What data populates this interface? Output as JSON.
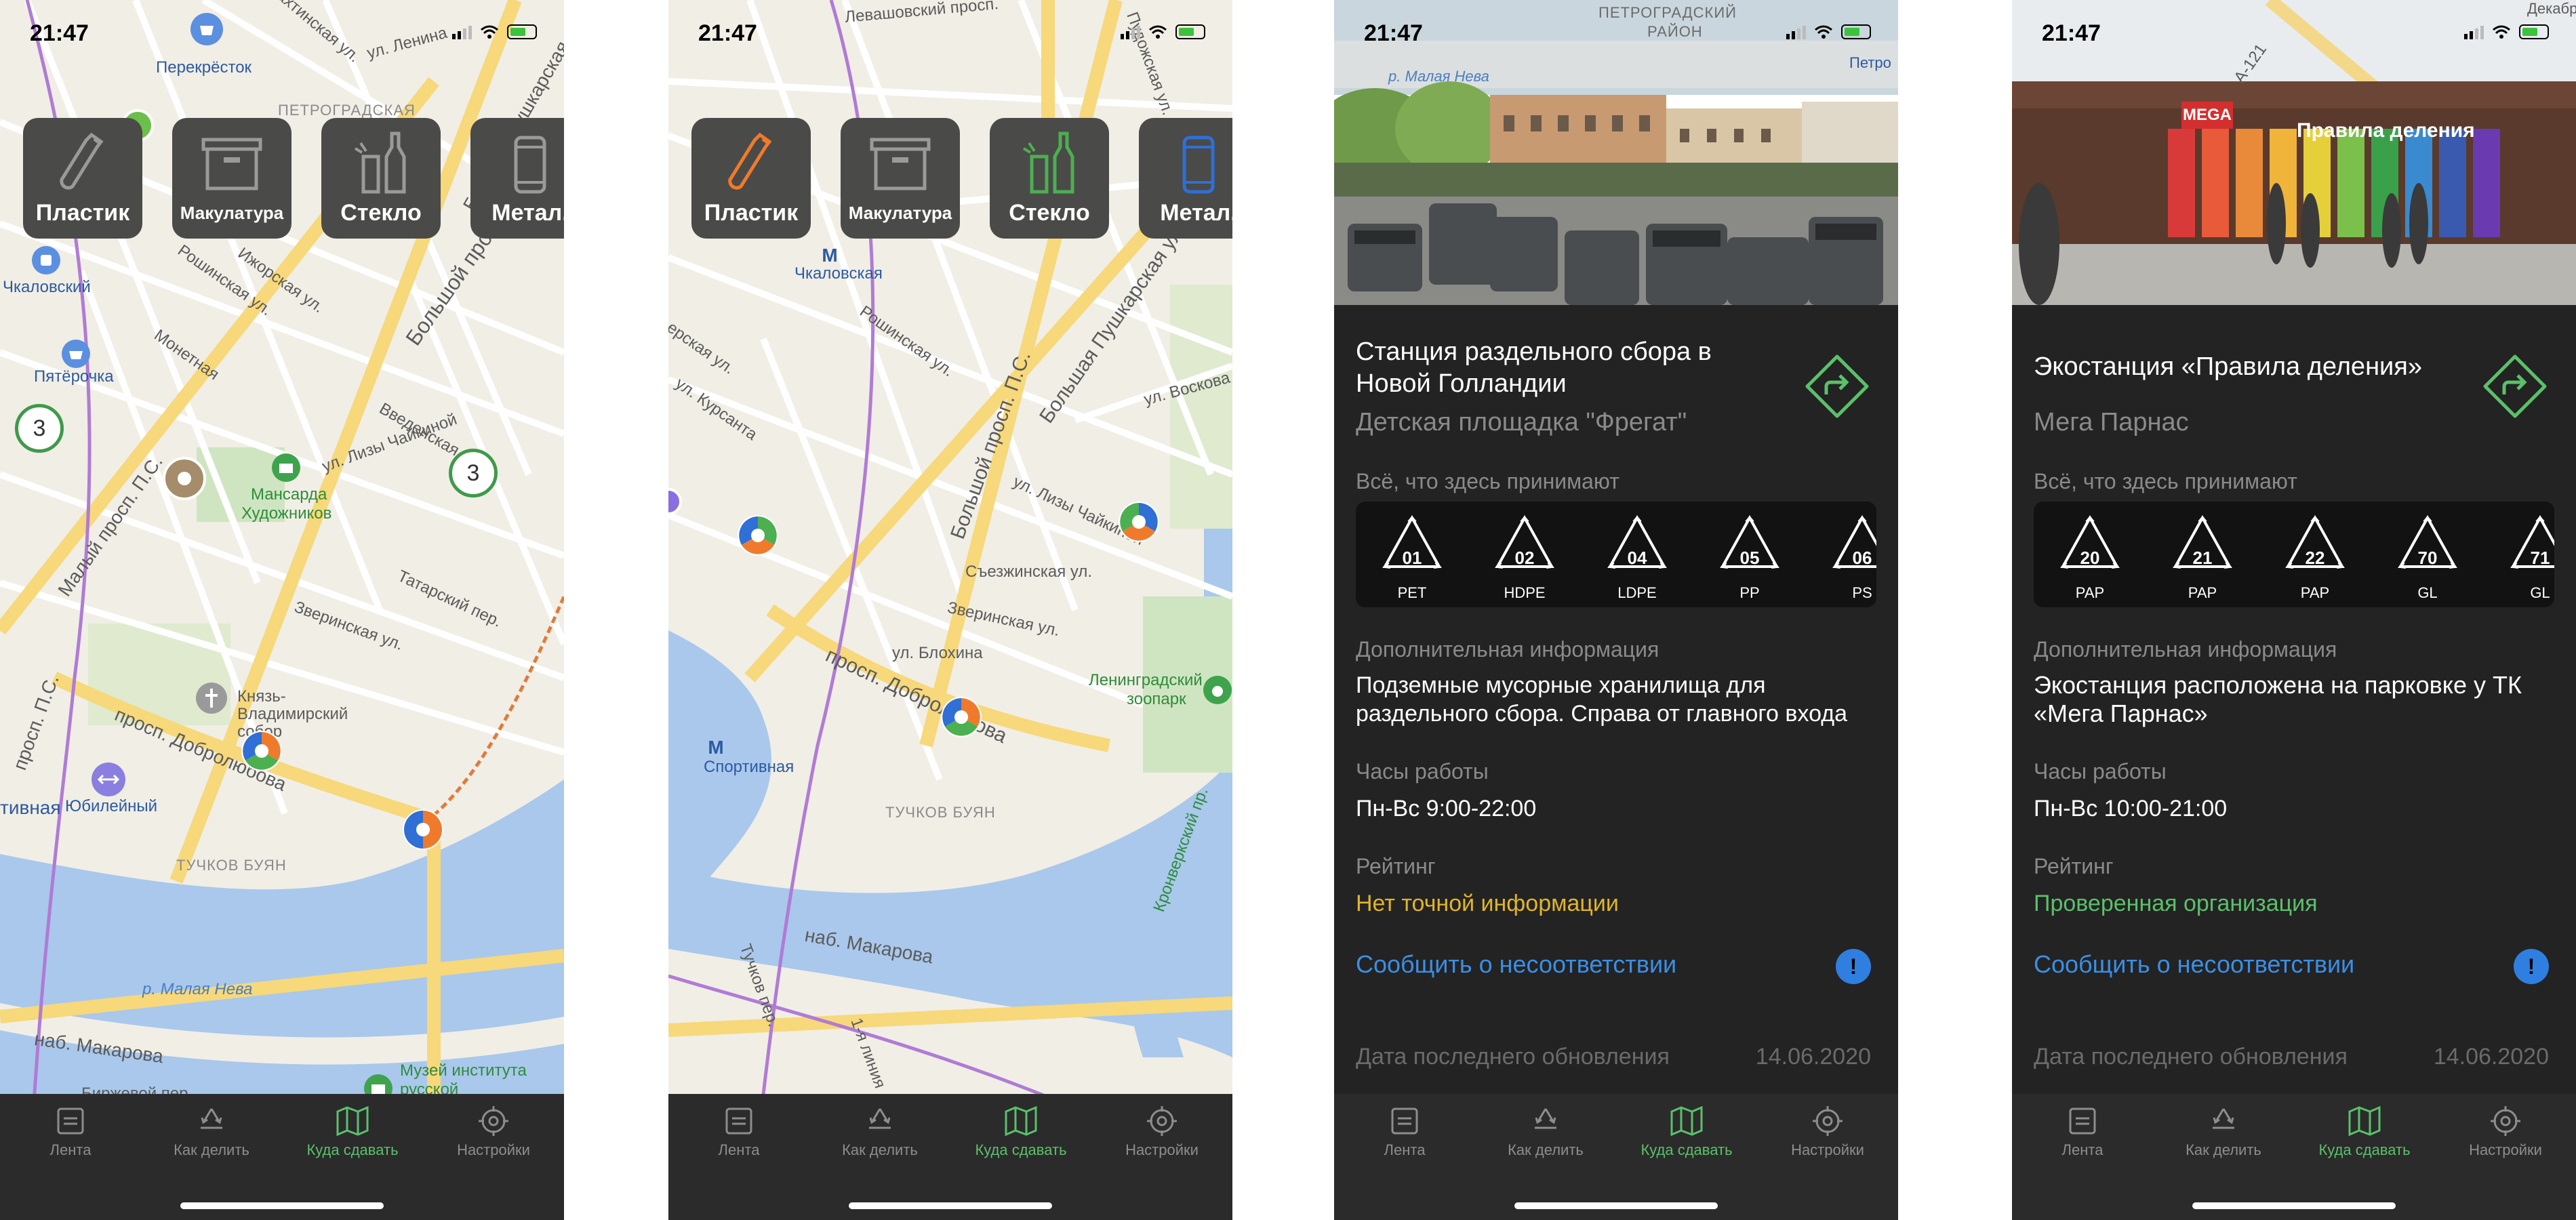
{
  "status": {
    "time": "21:47"
  },
  "chips": {
    "plastic": "Пластик",
    "paper": "Макулатура",
    "glass": "Стекло",
    "metal": "Метал."
  },
  "tabs": {
    "feed": "Лента",
    "howto": "Как делить",
    "where": "Куда сдавать",
    "settings": "Настройки"
  },
  "map1": {
    "labels": [
      "Лахтинская ул.",
      "ул. Ленина",
      "Перекрёсток",
      "ПЕТРОГРАДСКАЯ",
      "Чкаловский",
      "Пятёрочка",
      "Мансарда",
      "Художников",
      "Большой просп. П.С.",
      "Большая Пушкарская",
      "ул. Лизы Чайкиной",
      "Введенская ул.",
      "Рошинская ул.",
      "Ижорская ул.",
      "Монетная",
      "Малый просп. П.С.",
      "Татарский пер.",
      "Зверинская ул.",
      "Князь-",
      "Владимирский",
      "собор",
      "просп. Добролюбова",
      "Юбилейный",
      "ТУЧКОВ БУЯН",
      "р. Малая Нева",
      "наб. Макарова",
      "Биржевой пер.",
      "Музей института",
      "русской",
      "просп. П.С.",
      "тивная"
    ],
    "cluster_counts": [
      "3",
      "3"
    ]
  },
  "map2": {
    "labels": [
      "Левашовский просп.",
      "Пудожская ул.",
      "Чкаловская",
      "Рошинская ул.",
      "Большой просп. П.С.",
      "Большая Пушкарская ул.",
      "ул. Воскова",
      "ул. Лизы Чайкиной",
      "Съезжинская ул.",
      "Зверинская ул.",
      "ул. Блохина",
      "просп. Добролюбова",
      "Ленинградский",
      "зоопарк",
      "Спортивная",
      "ТУЧКОВ БУЯН",
      "наб. Макарова",
      "Тучков пер.",
      "1-я линия",
      "Кронверкский пр.",
      "ерская ул.",
      "ул. Курсанта"
    ]
  },
  "detail1": {
    "status_overlay": {
      "district1": "ПЕТРОГРАДСКИЙ",
      "district2": "РАЙОН",
      "street": "р. Малая Нева",
      "metro": "Петро"
    },
    "title": "Станция раздельного сбора в Новой Голландии",
    "subtitle": "Детская площадка \"Фрегат\"",
    "accepts_label": "Всё, что здесь принимают",
    "codes": [
      {
        "num": "01",
        "name": "PET"
      },
      {
        "num": "02",
        "name": "HDPE"
      },
      {
        "num": "04",
        "name": "LDPE"
      },
      {
        "num": "05",
        "name": "PP"
      },
      {
        "num": "06",
        "name": "PS"
      }
    ],
    "extra_label": "Дополнительная информация",
    "extra_text": "Подземные мусорные хранилища для раздельного сбора. Справа от главного входа",
    "hours_label": "Часы работы",
    "hours": "Пн-Вс 9:00-22:00",
    "rating_label": "Рейтинг",
    "rating": "Нет точной информации",
    "report": "Сообщить о несоответствии",
    "report_badge": "!",
    "updated_label": "Дата последнего обновления",
    "updated_date": "14.06.2020"
  },
  "detail2": {
    "status_overlay": {
      "road": "А-121",
      "corner": "Декабр"
    },
    "photo_sign": "Правила деления",
    "photo_logo": "MEGA",
    "title": "Экостанция «Правила деления»",
    "subtitle": "Мега Парнас",
    "accepts_label": "Всё, что здесь принимают",
    "codes": [
      {
        "num": "20",
        "name": "PAP"
      },
      {
        "num": "21",
        "name": "PAP"
      },
      {
        "num": "22",
        "name": "PAP"
      },
      {
        "num": "70",
        "name": "GL"
      },
      {
        "num": "71",
        "name": "GL"
      }
    ],
    "extra_label": "Дополнительная информация",
    "extra_text": "Экостанция расположена на парковке у ТК «Мега Парнас»",
    "hours_label": "Часы работы",
    "hours": "Пн-Вс 10:00-21:00",
    "rating_label": "Рейтинг",
    "rating": "Проверенная организация",
    "report": "Сообщить о несоответствии",
    "report_badge": "!",
    "updated_label": "Дата последнего обновления",
    "updated_date": "14.06.2020"
  },
  "colors": {
    "accent_green": "#5bc06b",
    "plastic_orange": "#f07a2c",
    "link_blue": "#3b8fe6",
    "rating_yellow": "#e0b52a",
    "chip_bg": "#4a4a48",
    "panel_bg": "#232323"
  }
}
